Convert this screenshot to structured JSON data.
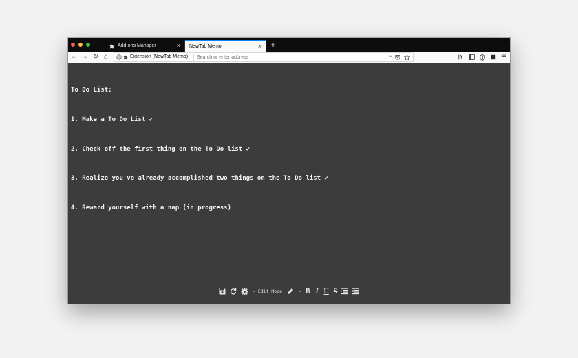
{
  "browser": {
    "tabs": [
      {
        "label": "Add-ons Manager",
        "icon": "puzzle-icon",
        "active": false
      },
      {
        "label": "NewTab Memo",
        "active": true
      }
    ],
    "new_tab_label": "+",
    "tab_close_glyph": "×"
  },
  "toolbar": {
    "back_glyph": "←",
    "forward_glyph": "→",
    "reload_glyph": "↻",
    "home_glyph": "⌂",
    "identity_label": "Extension (NewTab Memo)",
    "url_placeholder": "Search or enter address",
    "page_actions_glyph": "•••",
    "menu_glyph": "☰"
  },
  "memo": {
    "lines": [
      "To Do List:",
      "1. Make a To Do List ✔",
      "2. Check off the first thing on the To Do list ✔",
      "3. Realize you've already accomplished two things on the To Do list ✔",
      "4. Reward yourself with a nap (in progress)"
    ]
  },
  "editor": {
    "mode_label": "- Edit Mode",
    "separator": "-",
    "bold": "B",
    "italic": "I",
    "underline": "U",
    "strike": "S"
  },
  "colors": {
    "content_bg": "#3c3c3c",
    "tab_strip_bg": "#0d0d0d",
    "active_tab_accent": "#0a84ff"
  }
}
